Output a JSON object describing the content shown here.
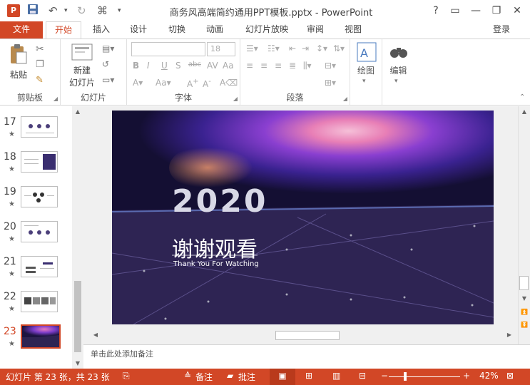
{
  "window": {
    "title": "商务风高端简约通用PPT模板.pptx - PowerPoint",
    "app_icon": "P",
    "controls": [
      "?",
      "▭",
      "—",
      "❐",
      "✕"
    ]
  },
  "tabs": {
    "file": "文件",
    "items": [
      "开始",
      "插入",
      "设计",
      "切换",
      "动画",
      "幻灯片放映",
      "审阅",
      "视图"
    ],
    "login": "登录"
  },
  "ribbon": {
    "clipboard": {
      "paste": "粘贴",
      "label": "剪贴板"
    },
    "slides": {
      "new_slide_line1": "新建",
      "new_slide_line2": "幻灯片",
      "label": "幻灯片"
    },
    "font": {
      "font_size": "18",
      "label": "字体"
    },
    "paragraph": {
      "label": "段落"
    },
    "drawing": {
      "label": "绘图"
    },
    "editing": {
      "label": "编辑"
    }
  },
  "thumbnails": [
    {
      "num": "17"
    },
    {
      "num": "18"
    },
    {
      "num": "19"
    },
    {
      "num": "20"
    },
    {
      "num": "21"
    },
    {
      "num": "22"
    },
    {
      "num": "23"
    }
  ],
  "slide": {
    "year": "2020",
    "thanks": "谢谢观看",
    "thanks_en": "Thank You For Watching"
  },
  "notes": {
    "placeholder": "单击此处添加备注"
  },
  "status": {
    "slide_info": "幻灯片 第 23 张，共 23 张",
    "notes_btn": "备注",
    "comments_btn": "批注",
    "zoom": "42%"
  },
  "colors": {
    "accent": "#d24726",
    "slide_bg": "#2e2453"
  }
}
